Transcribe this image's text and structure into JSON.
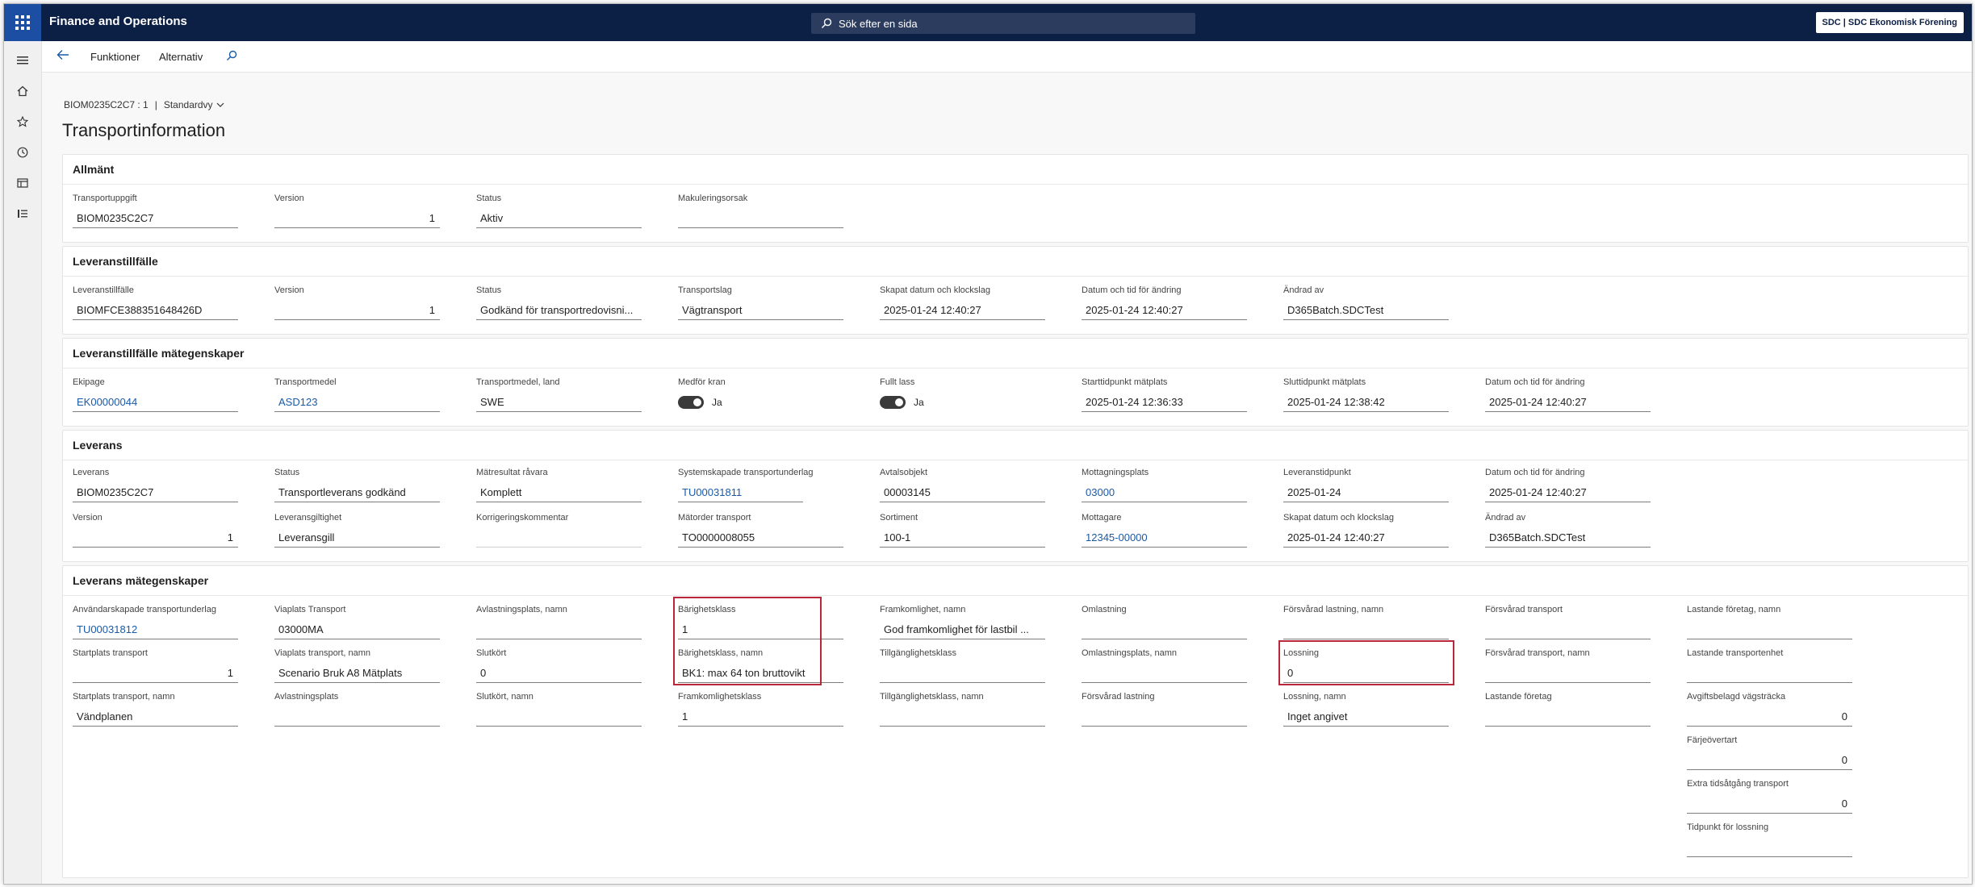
{
  "header": {
    "app_title": "Finance and Operations",
    "search_placeholder": "Sök efter en sida",
    "company": "SDC | SDC Ekonomisk Förening"
  },
  "actionbar": {
    "functions": "Funktioner",
    "options": "Alternativ"
  },
  "page": {
    "record_id": "BIOM0235C2C7 : 1",
    "view": "Standardvy",
    "title": "Transportinformation"
  },
  "sections": {
    "allmant": {
      "title": "Allmänt",
      "fields": [
        {
          "label": "Transportuppgift",
          "value": "BIOM0235C2C7"
        },
        {
          "label": "Version",
          "value": "1"
        },
        {
          "label": "Status",
          "value": "Aktiv"
        },
        {
          "label": "Makuleringsorsak",
          "value": ""
        }
      ]
    },
    "leveranstillfalle": {
      "title": "Leveranstillfälle",
      "fields": [
        {
          "label": "Leveranstillfälle",
          "value": "BIOMFCE388351648426D"
        },
        {
          "label": "Version",
          "value": "1"
        },
        {
          "label": "Status",
          "value": "Godkänd för transportredovisni..."
        },
        {
          "label": "Transportslag",
          "value": "Vägtransport"
        },
        {
          "label": "Skapat datum och klockslag",
          "value": "2025-01-24 12:40:27"
        },
        {
          "label": "Datum och tid för ändring",
          "value": "2025-01-24 12:40:27"
        },
        {
          "label": "Ändrad av",
          "value": "D365Batch.SDCTest"
        }
      ]
    },
    "lt_mategenskaper": {
      "title": "Leveranstillfälle mätegenskaper",
      "fields": [
        {
          "label": "Ekipage",
          "value": "EK00000044"
        },
        {
          "label": "Transportmedel",
          "value": "ASD123"
        },
        {
          "label": "Transportmedel, land",
          "value": "SWE"
        },
        {
          "label": "Medför kran",
          "value": "Ja"
        },
        {
          "label": "Fullt lass",
          "value": "Ja"
        },
        {
          "label": "Starttidpunkt mätplats",
          "value": "2025-01-24 12:36:33"
        },
        {
          "label": "Sluttidpunkt mätplats",
          "value": "2025-01-24 12:38:42"
        },
        {
          "label": "Datum och tid för ändring",
          "value": "2025-01-24 12:40:27"
        }
      ]
    },
    "leverans": {
      "title": "Leverans",
      "fields": [
        {
          "label": "Leverans",
          "value": "BIOM0235C2C7"
        },
        {
          "label": "Status",
          "value": "Transportleverans godkänd"
        },
        {
          "label": "Mätresultat råvara",
          "value": "Komplett"
        },
        {
          "label": "Systemskapade transportunderlag",
          "value": "TU00031811"
        },
        {
          "label": "Avtalsobjekt",
          "value": "00003145"
        },
        {
          "label": "Mottagningsplats",
          "value": "03000"
        },
        {
          "label": "Leveranstidpunkt",
          "value": "2025-01-24"
        },
        {
          "label": "Datum och tid för ändring",
          "value": "2025-01-24 12:40:27"
        },
        {
          "label": "Version",
          "value": "1"
        },
        {
          "label": "Leveransgiltighet",
          "value": "Leveransgill"
        },
        {
          "label": "Korrigeringskommentar",
          "value": ""
        },
        {
          "label": "Mätorder transport",
          "value": "TO0000008055"
        },
        {
          "label": "Sortiment",
          "value": "100-1"
        },
        {
          "label": "Mottagare",
          "value": "12345-00000"
        },
        {
          "label": "Skapat datum och klockslag",
          "value": "2025-01-24 12:40:27"
        },
        {
          "label": "Ändrad av",
          "value": "D365Batch.SDCTest"
        }
      ]
    },
    "lev_mategenskaper": {
      "title": "Leverans mätegenskaper",
      "fields": [
        {
          "label": "Användarskapade transportunderlag",
          "value": "TU00031812"
        },
        {
          "label": "Startplats transport",
          "value": "1"
        },
        {
          "label": "Startplats transport, namn",
          "value": "Vändplanen"
        },
        {
          "label": "Viaplats Transport",
          "value": "03000MA"
        },
        {
          "label": "Viaplats transport, namn",
          "value": "Scenario Bruk A8 Mätplats"
        },
        {
          "label": "Avlastningsplats",
          "value": ""
        },
        {
          "label": "Avlastningsplats, namn",
          "value": ""
        },
        {
          "label": "Slutkört",
          "value": "0"
        },
        {
          "label": "Slutkört, namn",
          "value": ""
        },
        {
          "label": "Bärighetsklass",
          "value": "1"
        },
        {
          "label": "Bärighetsklass, namn",
          "value": "BK1: max 64 ton bruttovikt"
        },
        {
          "label": "Framkomlighetsklass",
          "value": "1"
        },
        {
          "label": "Framkomlighet, namn",
          "value": "God framkomlighet för lastbil ..."
        },
        {
          "label": "Tillgänglighetsklass",
          "value": ""
        },
        {
          "label": "Tillgänglighetsklass, namn",
          "value": ""
        },
        {
          "label": "Omlastning",
          "value": ""
        },
        {
          "label": "Omlastningsplats, namn",
          "value": ""
        },
        {
          "label": "Försvårad lastning",
          "value": ""
        },
        {
          "label": "Försvårad lastning, namn",
          "value": ""
        },
        {
          "label": "Lossning",
          "value": "0"
        },
        {
          "label": "Lossning, namn",
          "value": "Inget angivet"
        },
        {
          "label": "Försvårad transport",
          "value": ""
        },
        {
          "label": "Försvårad transport, namn",
          "value": ""
        },
        {
          "label": "Lastande företag",
          "value": ""
        },
        {
          "label": "Lastande företag, namn",
          "value": ""
        },
        {
          "label": "Lastande transportenhet",
          "value": ""
        },
        {
          "label": "Avgiftsbelagd vägsträcka",
          "value": "0"
        },
        {
          "label": "Färjeövertart",
          "value": "0"
        },
        {
          "label": "Extra tidsåtgång transport",
          "value": "0"
        },
        {
          "label": "Tidpunkt för lossning",
          "value": ""
        }
      ]
    }
  },
  "colors": {
    "topbar": "#0c1f44",
    "waffle": "#1c4fa3",
    "link": "#1a5aa8",
    "highlight": "#b8283a"
  }
}
